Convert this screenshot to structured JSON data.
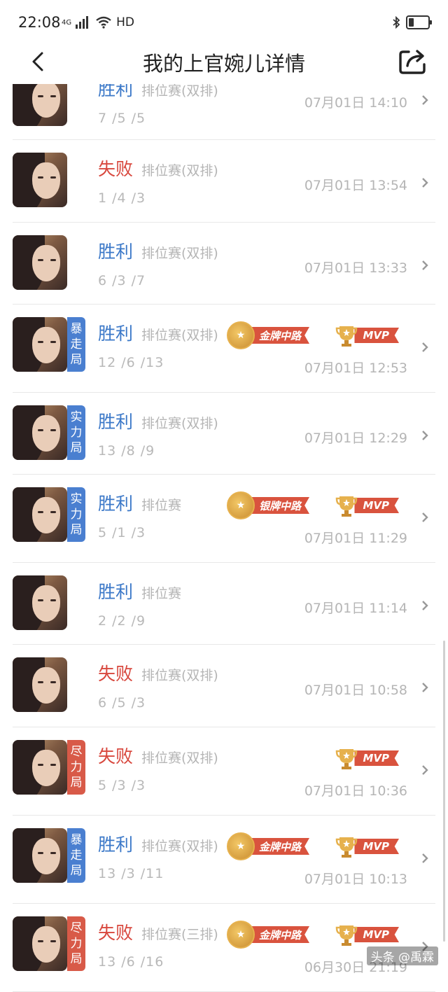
{
  "status": {
    "time": "22:08",
    "net": "4G",
    "hd": "HD"
  },
  "nav": {
    "title": "我的上官婉儿详情"
  },
  "matches": [
    {
      "result": "胜利",
      "result_type": "win",
      "mode": "排位赛(双排)",
      "kda": "7 /5 /5",
      "time": "07月01日 14:10",
      "tag": null,
      "badges": []
    },
    {
      "result": "失败",
      "result_type": "lose",
      "mode": "排位赛(双排)",
      "kda": "1 /4 /3",
      "time": "07月01日 13:54",
      "tag": null,
      "badges": []
    },
    {
      "result": "胜利",
      "result_type": "win",
      "mode": "排位赛(双排)",
      "kda": "6 /3 /7",
      "time": "07月01日 13:33",
      "tag": null,
      "badges": []
    },
    {
      "result": "胜利",
      "result_type": "win",
      "mode": "排位赛(双排)",
      "kda": "12 /6 /13",
      "time": "07月01日 12:53",
      "tag": {
        "text": [
          "暴",
          "走",
          "局"
        ],
        "color": "blue"
      },
      "badges": [
        {
          "kind": "medal",
          "label": "金牌中路"
        },
        {
          "kind": "mvp",
          "label": "MVP"
        }
      ]
    },
    {
      "result": "胜利",
      "result_type": "win",
      "mode": "排位赛(双排)",
      "kda": "13 /8 /9",
      "time": "07月01日 12:29",
      "tag": {
        "text": [
          "实",
          "力",
          "局"
        ],
        "color": "blue"
      },
      "badges": []
    },
    {
      "result": "胜利",
      "result_type": "win",
      "mode": "排位赛",
      "kda": "5 /1 /3",
      "time": "07月01日 11:29",
      "tag": {
        "text": [
          "实",
          "力",
          "局"
        ],
        "color": "blue"
      },
      "badges": [
        {
          "kind": "medal",
          "label": "银牌中路"
        },
        {
          "kind": "mvp",
          "label": "MVP"
        }
      ]
    },
    {
      "result": "胜利",
      "result_type": "win",
      "mode": "排位赛",
      "kda": "2 /2 /9",
      "time": "07月01日 11:14",
      "tag": null,
      "badges": []
    },
    {
      "result": "失败",
      "result_type": "lose",
      "mode": "排位赛(双排)",
      "kda": "6 /5 /3",
      "time": "07月01日 10:58",
      "tag": null,
      "badges": []
    },
    {
      "result": "失败",
      "result_type": "lose",
      "mode": "排位赛(双排)",
      "kda": "5 /3 /3",
      "time": "07月01日 10:36",
      "tag": {
        "text": [
          "尽",
          "力",
          "局"
        ],
        "color": "red"
      },
      "badges": [
        {
          "kind": "mvp",
          "label": "MVP"
        }
      ]
    },
    {
      "result": "胜利",
      "result_type": "win",
      "mode": "排位赛(双排)",
      "kda": "13 /3 /11",
      "time": "07月01日 10:13",
      "tag": {
        "text": [
          "暴",
          "走",
          "局"
        ],
        "color": "blue"
      },
      "badges": [
        {
          "kind": "medal",
          "label": "金牌中路"
        },
        {
          "kind": "mvp",
          "label": "MVP"
        }
      ]
    },
    {
      "result": "失败",
      "result_type": "lose",
      "mode": "排位赛(三排)",
      "kda": "13 /6 /16",
      "time": "06月30日 21:19",
      "tag": {
        "text": [
          "尽",
          "力",
          "局"
        ],
        "color": "red"
      },
      "badges": [
        {
          "kind": "medal",
          "label": "金牌中路"
        },
        {
          "kind": "mvp",
          "label": "MVP"
        }
      ]
    }
  ],
  "watermark": "头条 @禹霖",
  "colors": {
    "win": "#3b78c8",
    "lose": "#d8483e",
    "tag_blue": "#4a7fd0",
    "tag_red": "#d85a48",
    "ribbon": "#d9533e"
  }
}
